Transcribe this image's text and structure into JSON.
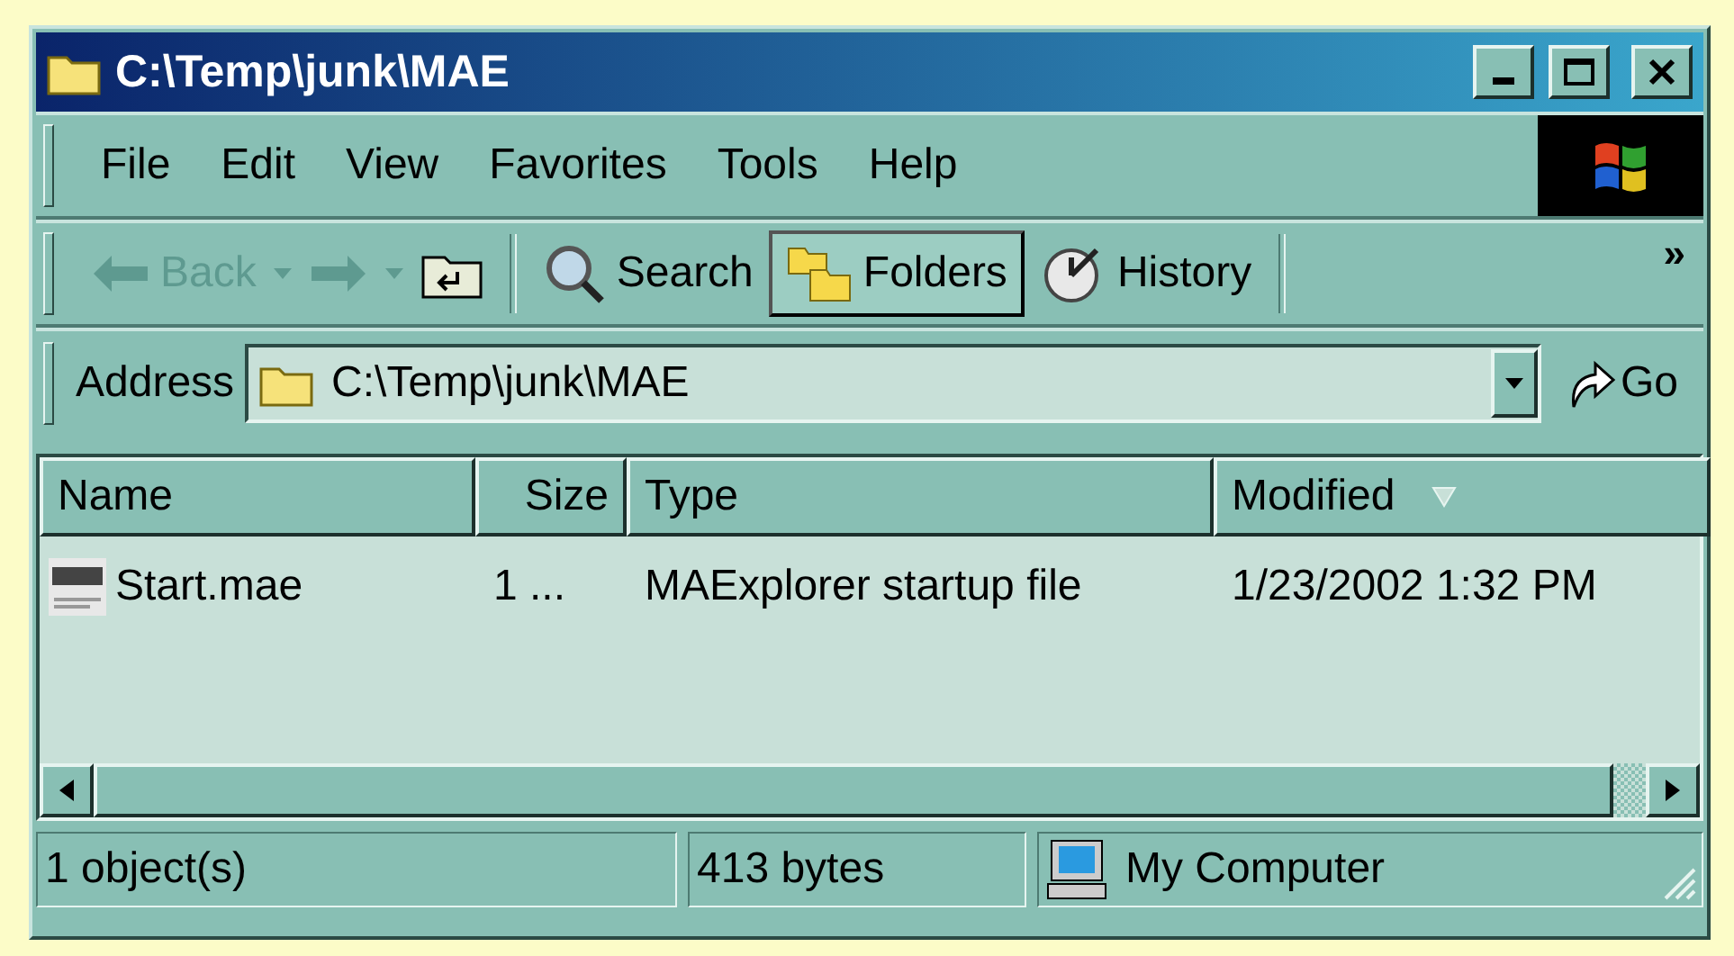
{
  "window": {
    "title": "C:\\Temp\\junk\\MAE"
  },
  "menu": [
    {
      "label": "File"
    },
    {
      "label": "Edit"
    },
    {
      "label": "View"
    },
    {
      "label": "Favorites"
    },
    {
      "label": "Tools"
    },
    {
      "label": "Help"
    }
  ],
  "toolbar": [
    {
      "kind": "back",
      "label": "Back",
      "disabled": true,
      "selected": false
    },
    {
      "kind": "forward",
      "disabled": true,
      "selected": false
    },
    {
      "kind": "up",
      "disabled": false,
      "selected": false
    },
    {
      "kind": "separator"
    },
    {
      "kind": "search",
      "label": "Search",
      "disabled": false,
      "selected": false
    },
    {
      "kind": "folders",
      "label": "Folders",
      "disabled": false,
      "selected": true
    },
    {
      "kind": "history",
      "label": "History",
      "disabled": false,
      "selected": false
    },
    {
      "kind": "separator"
    },
    {
      "kind": "more",
      "label": "»"
    }
  ],
  "address": {
    "label": "Address",
    "value": "C:\\Temp\\junk\\MAE",
    "go": "Go"
  },
  "table": {
    "columns": [
      {
        "label": "Name",
        "sorted": false
      },
      {
        "label": "Size",
        "sorted": false
      },
      {
        "label": "Type",
        "sorted": false
      },
      {
        "label": "Modified",
        "sorted": true
      }
    ],
    "rows": [
      {
        "name": "Start.mae",
        "size": "1 ...",
        "type": "MAExplorer startup file",
        "modified": "1/23/2002 1:32 PM",
        "selected": false
      }
    ]
  },
  "status_bar": {
    "objects": "1 object(s)",
    "size": "413 bytes",
    "zone": "My Computer"
  }
}
